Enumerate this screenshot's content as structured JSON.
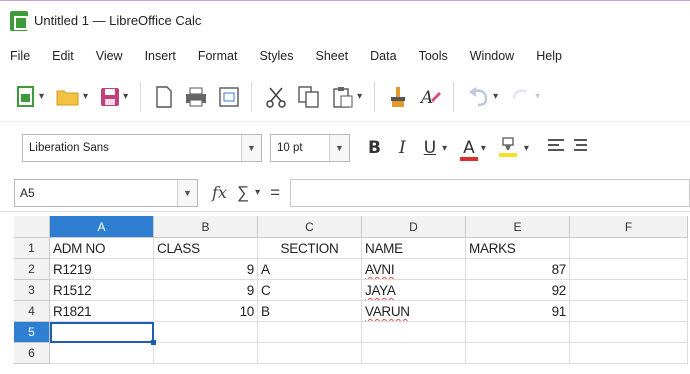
{
  "window": {
    "title": "Untitled 1 — LibreOffice Calc"
  },
  "menu": [
    {
      "label": "File"
    },
    {
      "label": "Edit"
    },
    {
      "label": "View"
    },
    {
      "label": "Insert"
    },
    {
      "label": "Format"
    },
    {
      "label": "Styles"
    },
    {
      "label": "Sheet"
    },
    {
      "label": "Data"
    },
    {
      "label": "Tools"
    },
    {
      "label": "Window"
    },
    {
      "label": "Help"
    }
  ],
  "toolbar": {
    "icons": [
      "new-icon",
      "open-icon",
      "save-icon",
      "export-pdf-icon",
      "print-icon",
      "print-preview-icon",
      "cut-icon",
      "copy-icon",
      "paste-icon",
      "clone-formatting-icon",
      "clear-formatting-icon",
      "undo-icon",
      "redo-icon"
    ]
  },
  "format": {
    "font_name": "Liberation Sans",
    "font_size": "10 pt",
    "bold": "B",
    "italic": "I",
    "underline": "U",
    "font_color_letter": "A",
    "font_color": "#d9302c",
    "highlight_color": "#f5e12a"
  },
  "formula_bar": {
    "cell_ref": "A5",
    "fx": "fx",
    "sigma": "∑",
    "equals": "=",
    "content": ""
  },
  "sheet": {
    "columns": [
      "A",
      "B",
      "C",
      "D",
      "E",
      "F"
    ],
    "active_column": "A",
    "active_row": "5",
    "rows": [
      {
        "num": "1",
        "cells": [
          "ADM NO",
          "CLASS",
          "SECTION",
          "NAME",
          "MARKS",
          ""
        ]
      },
      {
        "num": "2",
        "cells": [
          "R1219",
          "9",
          "A",
          "AVNI",
          "87",
          ""
        ]
      },
      {
        "num": "3",
        "cells": [
          "R1512",
          "9",
          "C",
          "JAYA",
          "92",
          ""
        ]
      },
      {
        "num": "4",
        "cells": [
          "R1821",
          "10",
          "B",
          "VARUN",
          "91",
          ""
        ]
      },
      {
        "num": "5",
        "cells": [
          "",
          "",
          "",
          "",
          "",
          ""
        ]
      },
      {
        "num": "6",
        "cells": [
          "",
          "",
          "",
          "",
          "",
          ""
        ]
      }
    ]
  },
  "colors": {
    "accent": "#2e7fd1",
    "selection": "#1c5fb2",
    "app_icon": "#3d9b3a"
  }
}
